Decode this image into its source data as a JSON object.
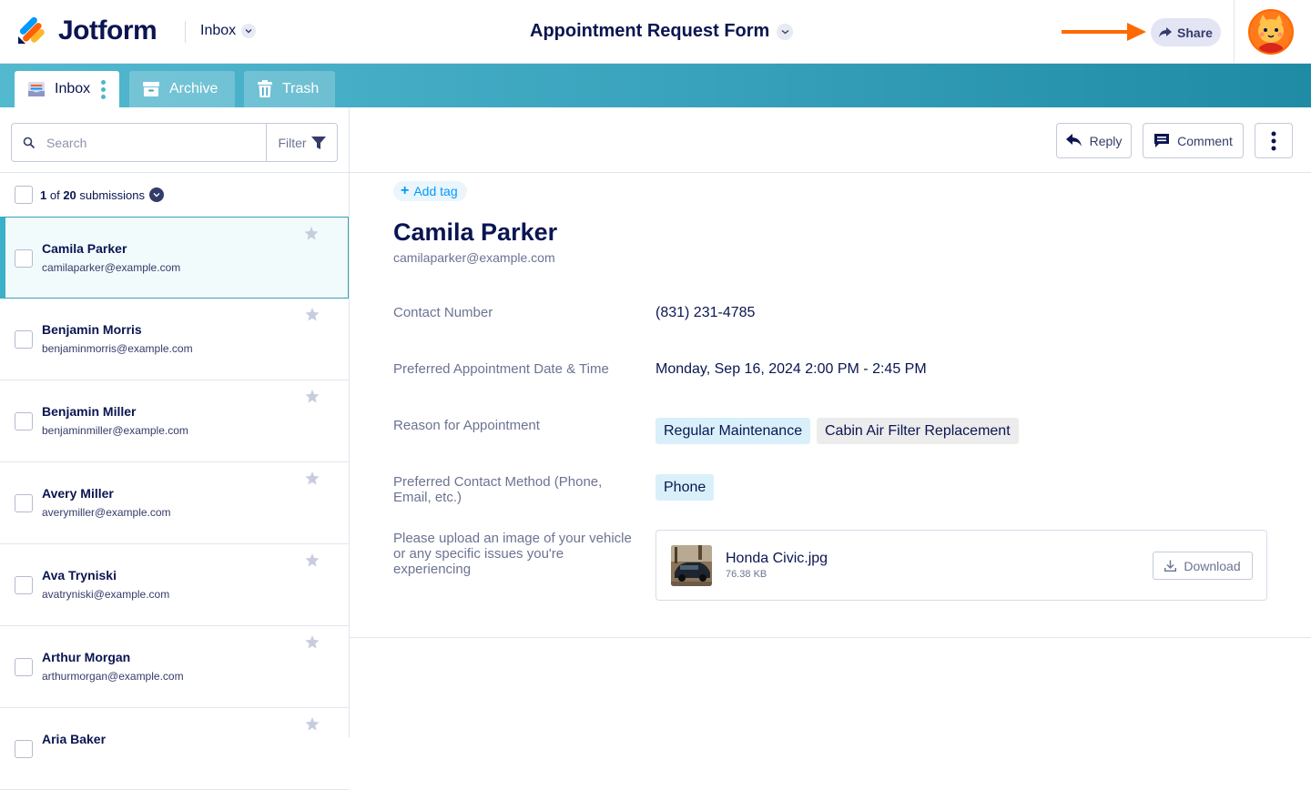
{
  "header": {
    "brand": "Jotform",
    "inbox_label": "Inbox",
    "form_title": "Appointment Request Form",
    "share_label": "Share",
    "accent_arrow_color": "#ff6a00"
  },
  "tabs": [
    {
      "label": "Inbox",
      "icon": "inbox-icon",
      "active": true
    },
    {
      "label": "Archive",
      "icon": "archive-icon",
      "active": false
    },
    {
      "label": "Trash",
      "icon": "trash-icon",
      "active": false
    }
  ],
  "search": {
    "placeholder": "Search",
    "filter_label": "Filter"
  },
  "list_header": {
    "current": "1",
    "of": "of",
    "total": "20",
    "suffix": "submissions"
  },
  "submissions": [
    {
      "name": "Camila Parker",
      "email": "camilaparker@example.com",
      "selected": true
    },
    {
      "name": "Benjamin Morris",
      "email": "benjaminmorris@example.com",
      "selected": false
    },
    {
      "name": "Benjamin Miller",
      "email": "benjaminmiller@example.com",
      "selected": false
    },
    {
      "name": "Avery Miller",
      "email": "averymiller@example.com",
      "selected": false
    },
    {
      "name": "Ava Tryniski",
      "email": "avatryniski@example.com",
      "selected": false
    },
    {
      "name": "Arthur Morgan",
      "email": "arthurmorgan@example.com",
      "selected": false
    },
    {
      "name": "Aria Baker",
      "email": "",
      "selected": false
    }
  ],
  "toolbar": {
    "reply_label": "Reply",
    "comment_label": "Comment"
  },
  "detail": {
    "add_tag": "Add tag",
    "name": "Camila Parker",
    "email": "camilaparker@example.com",
    "fields": {
      "contact_label": "Contact Number",
      "contact_value": "(831) 231-4785",
      "date_label": "Preferred Appointment Date & Time",
      "date_value": "Monday, Sep 16, 2024 2:00 PM - 2:45 PM",
      "reason_label": "Reason for Appointment",
      "reason_values": [
        "Regular Maintenance",
        "Cabin Air Filter Replacement"
      ],
      "method_label": "Preferred Contact Method (Phone, Email, etc.)",
      "method_value": "Phone",
      "upload_label": "Please upload an image of your vehicle or any specific issues you're experiencing"
    },
    "file": {
      "name": "Honda Civic.jpg",
      "size": "76.38 KB",
      "download_label": "Download"
    }
  }
}
